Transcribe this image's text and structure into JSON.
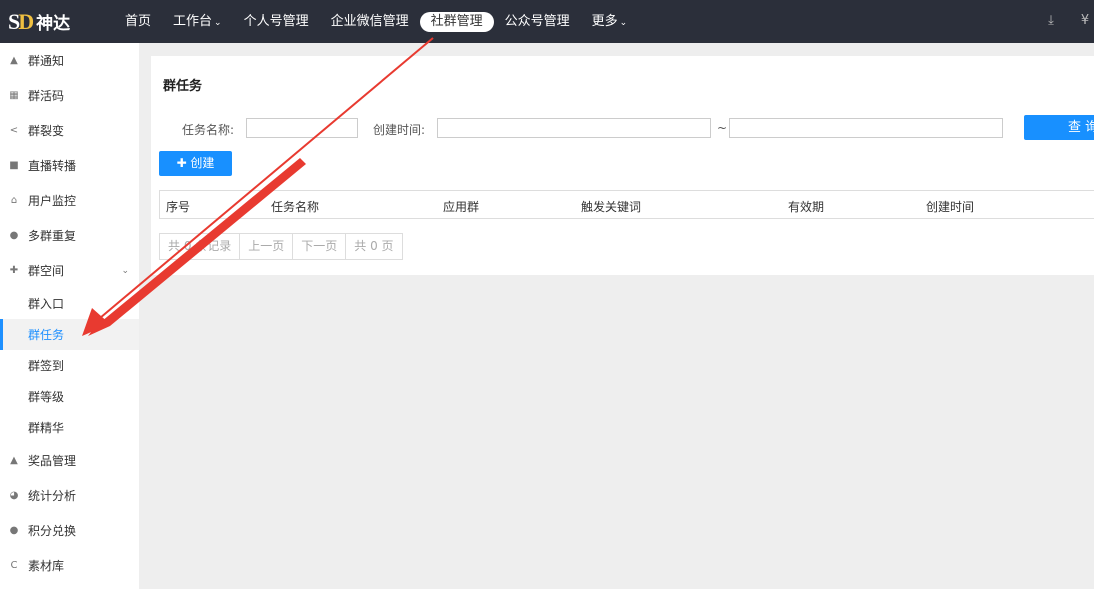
{
  "brand": {
    "mark_s": "S",
    "mark_d": "D",
    "name": "神达"
  },
  "nav": [
    {
      "label": "首页"
    },
    {
      "label": "工作台",
      "caret": "⌄"
    },
    {
      "label": "个人号管理"
    },
    {
      "label": "企业微信管理"
    },
    {
      "label": "社群管理"
    },
    {
      "label": "公众号管理"
    },
    {
      "label": "更多",
      "caret": "⌄"
    }
  ],
  "top_icons": [
    {
      "name": "download-icon",
      "glyph": "⤓"
    },
    {
      "name": "yen-icon",
      "glyph": "¥"
    }
  ],
  "sidebar": {
    "items": [
      {
        "label": "群通知",
        "icon": "bell-icon",
        "glyph": "▲"
      },
      {
        "label": "群活码",
        "icon": "qrcode-icon",
        "glyph": "▦"
      },
      {
        "label": "群裂变",
        "icon": "share-icon",
        "glyph": "<"
      },
      {
        "label": "直播转播",
        "icon": "video-icon",
        "glyph": "■"
      },
      {
        "label": "用户监控",
        "icon": "home-icon",
        "glyph": "⌂"
      },
      {
        "label": "多群重复",
        "icon": "users-icon",
        "glyph": "●"
      },
      {
        "label": "群空间",
        "icon": "puzzle-icon",
        "glyph": "✚",
        "caret": "⌄"
      }
    ],
    "sub_items": [
      {
        "label": "群入口"
      },
      {
        "label": "群任务"
      },
      {
        "label": "群签到"
      },
      {
        "label": "群等级"
      },
      {
        "label": "群精华"
      }
    ],
    "items_after": [
      {
        "label": "奖品管理",
        "icon": "thumbs-up-icon",
        "glyph": "▲"
      },
      {
        "label": "统计分析",
        "icon": "pie-chart-icon",
        "glyph": "◕"
      },
      {
        "label": "积分兑换",
        "icon": "users-icon",
        "glyph": "●"
      },
      {
        "label": "素材库",
        "icon": "refresh-icon",
        "glyph": "C"
      }
    ]
  },
  "page": {
    "title": "群任务",
    "filters": {
      "task_name_label": "任务名称:",
      "created_label": "创建时间:",
      "tilde": "~"
    },
    "search_button": "查 询",
    "create_button": "✚ 创建",
    "table_headers": [
      "序号",
      "任务名称",
      "应用群",
      "触发关键词",
      "有效期",
      "创建时间"
    ],
    "pager": [
      "共 0 条记录",
      "上一页",
      "下一页",
      "共 0 页"
    ]
  },
  "colors": {
    "accent": "#1890ff",
    "topbar": "#2b2f3a",
    "arrow": "#e83a30"
  }
}
